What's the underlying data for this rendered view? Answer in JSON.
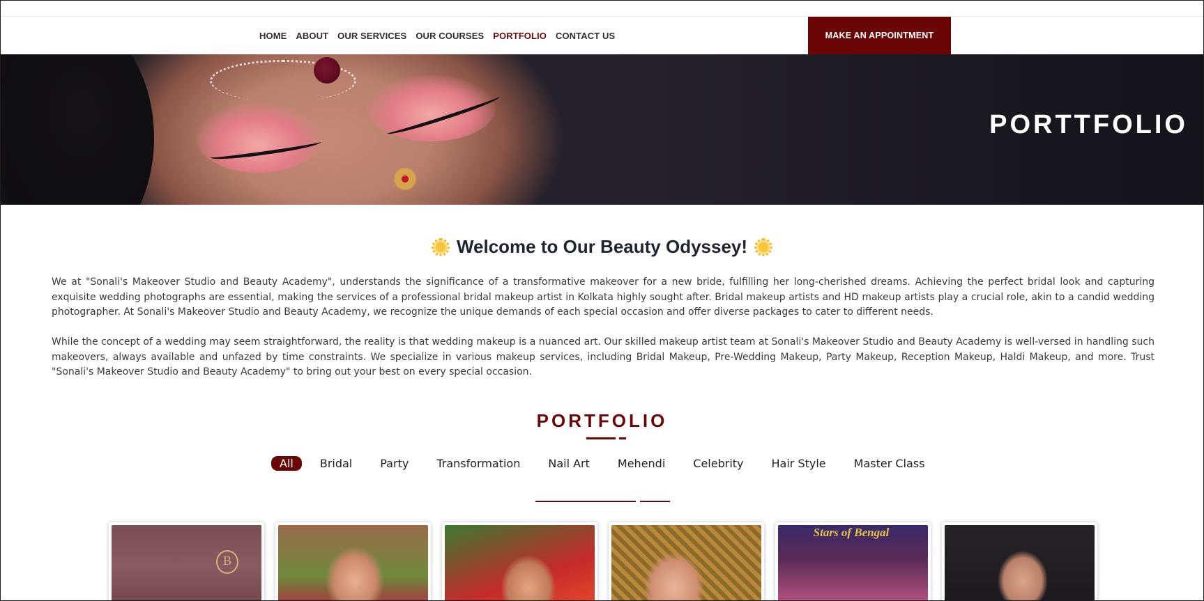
{
  "nav": {
    "items": [
      {
        "label": "HOME"
      },
      {
        "label": "ABOUT"
      },
      {
        "label": "OUR SERVICES"
      },
      {
        "label": "OUR COURSES"
      },
      {
        "label": "PORTFOLIO"
      },
      {
        "label": "CONTACT US"
      }
    ],
    "active": "PORTFOLIO",
    "cta_label": "MAKE AN APPOINTMENT"
  },
  "hero": {
    "title": "PORTTFOLIO"
  },
  "intro": {
    "heading": "Welcome to Our Beauty Odyssey!",
    "paragraphs": [
      "We at \"Sonali's Makeover Studio and Beauty Academy\", understands the significance of a transformative makeover for a new bride, fulfilling her long-cherished dreams. Achieving the perfect bridal look and capturing exquisite wedding photographs are essential, making the services of a professional bridal makeup artist in Kolkata highly sought after. Bridal makeup artists and HD makeup artists play a crucial role, akin to a candid wedding photographer. At Sonali's Makeover Studio and Beauty Academy, we recognize the unique demands of each special occasion and offer diverse packages to cater to different needs.",
      "While the concept of a wedding may seem straightforward, the reality is that wedding makeup is a nuanced art. Our skilled makeup artist team at Sonali's Makeover Studio and Beauty Academy is well-versed in handling such makeovers, always available and unfazed by time constraints. We specialize in various makeup services, including Bridal Makeup, Pre-Wedding Makeup, Party Makeup, Reception Makeup, Haldi Makeup, and more. Trust \"Sonali's Makeover Studio and Beauty Academy\" to bring out your best on every special occasion."
    ]
  },
  "portfolio": {
    "title": "PORTFOLIO",
    "filters": [
      {
        "label": "All",
        "selected": true
      },
      {
        "label": "Bridal"
      },
      {
        "label": "Party"
      },
      {
        "label": "Transformation"
      },
      {
        "label": "Nail Art"
      },
      {
        "label": "Mehendi"
      },
      {
        "label": "Celebrity"
      },
      {
        "label": "Hair Style"
      },
      {
        "label": "Master Class"
      }
    ],
    "gallery_count": 6
  },
  "colors": {
    "brand": "#6b0606",
    "text": "#2b2b2b",
    "accent_sun": "#f6c53a"
  }
}
